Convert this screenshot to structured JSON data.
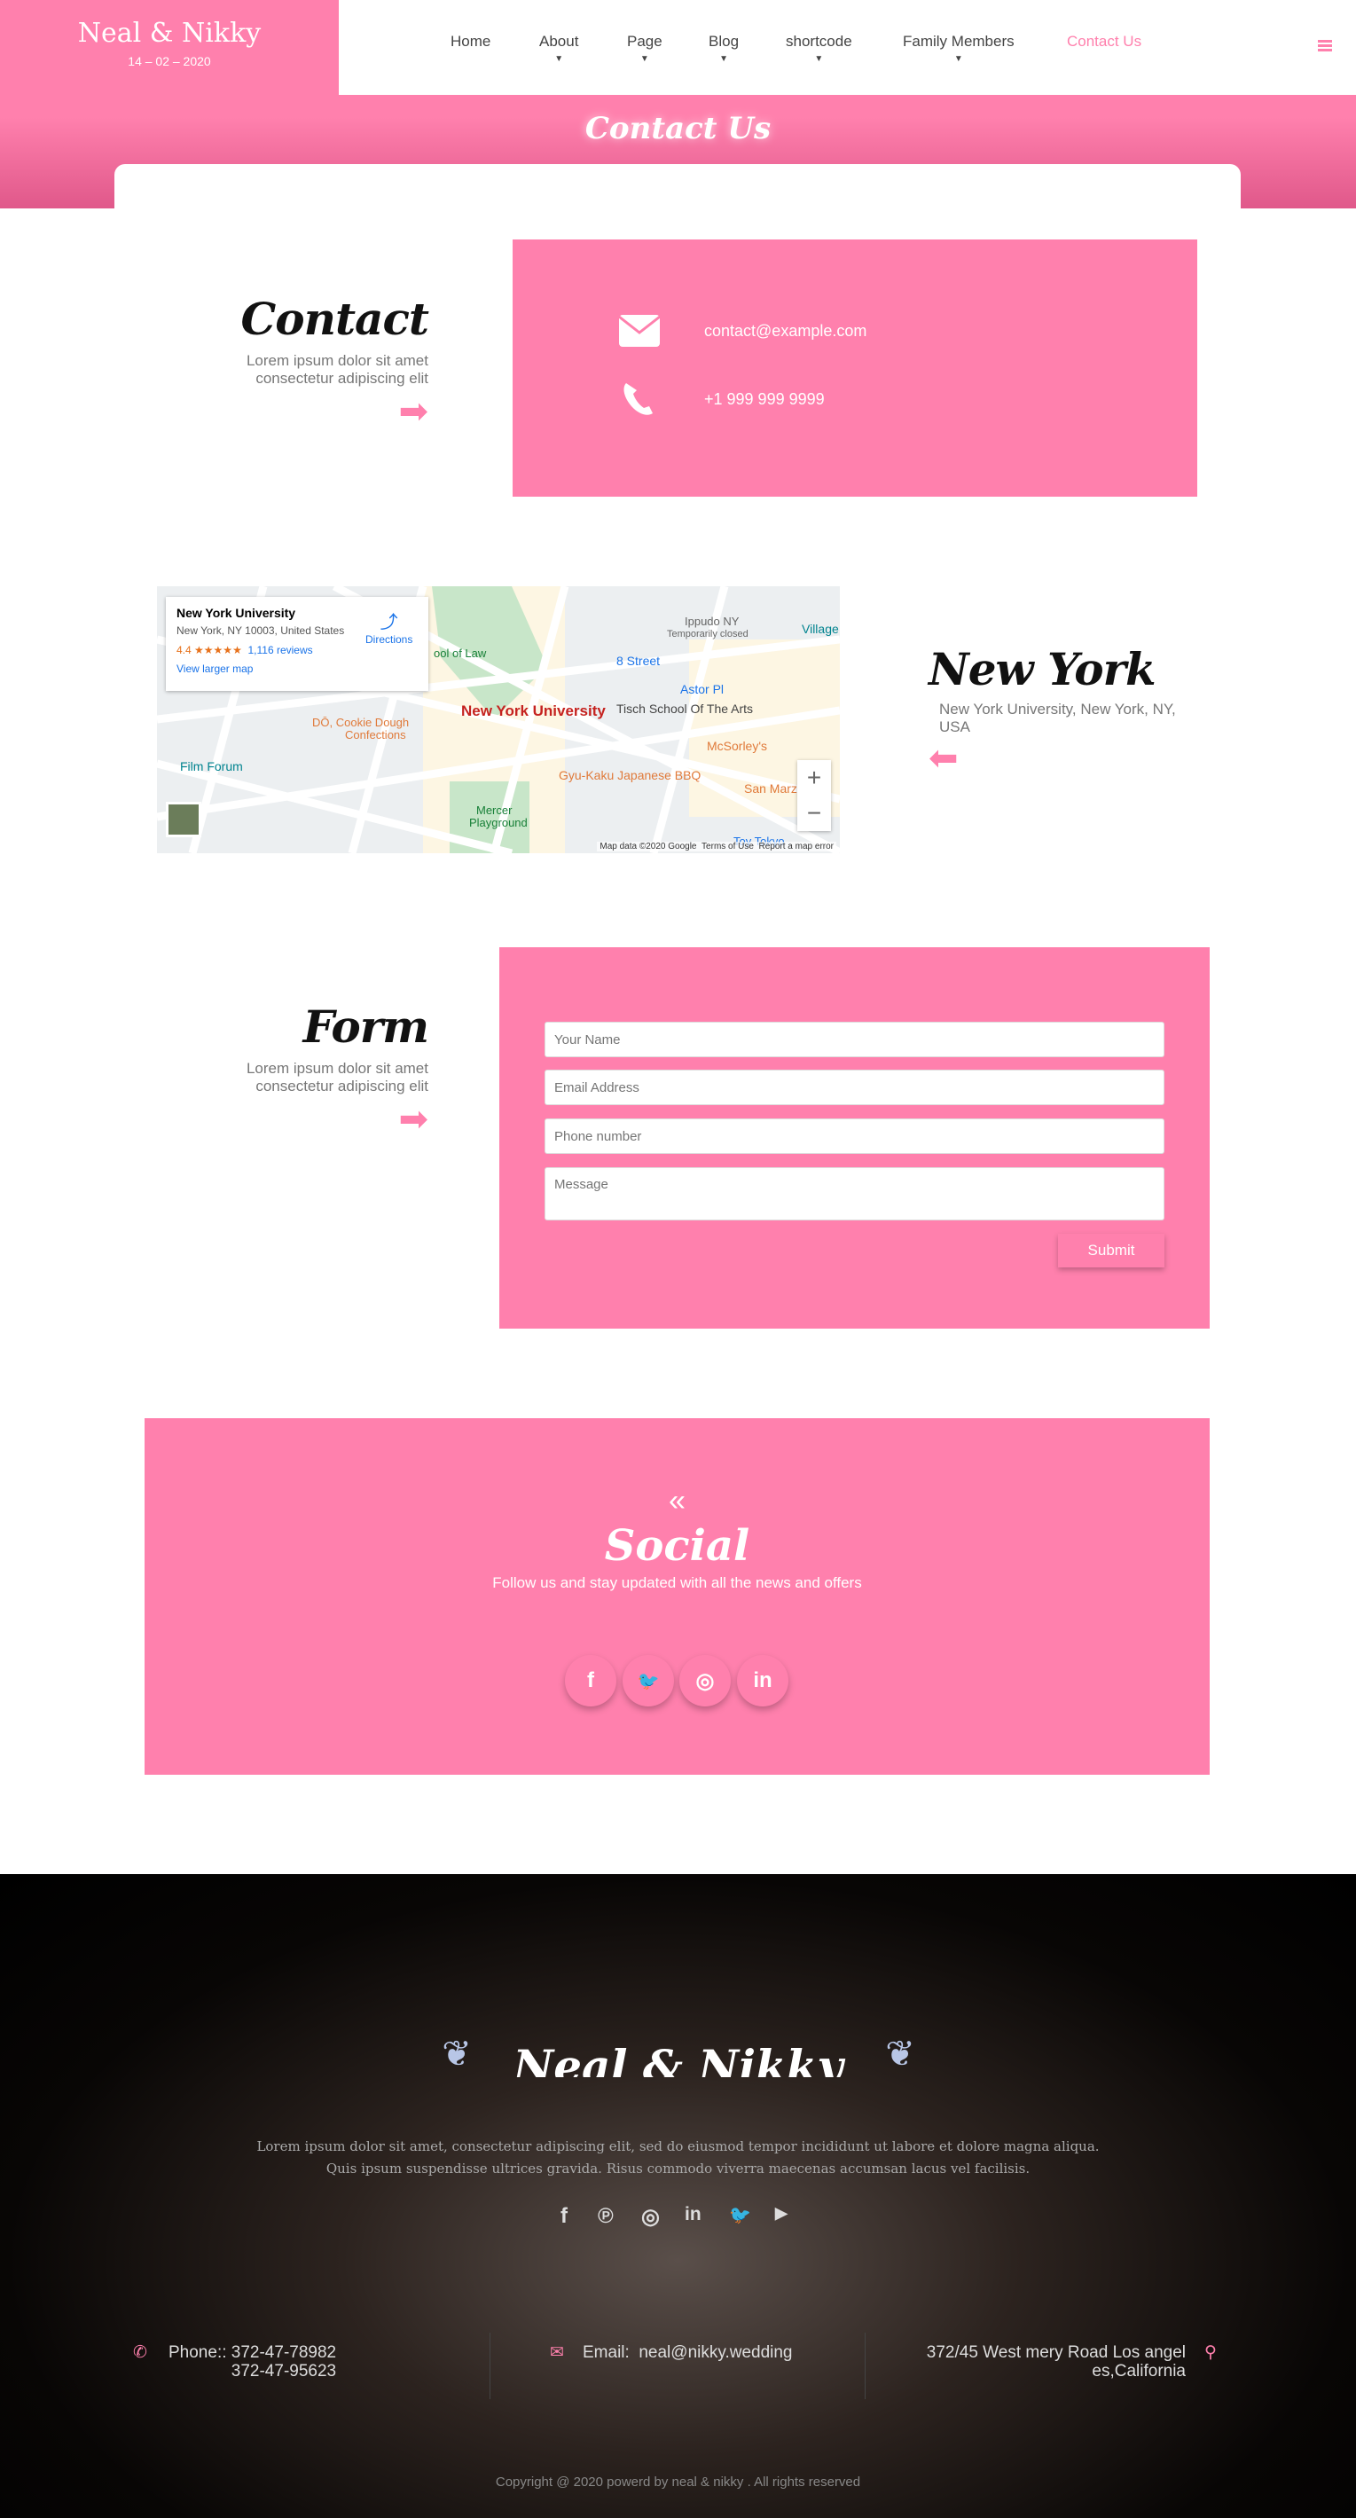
{
  "brand": {
    "title": "Neal & Nikky",
    "date": "14 – 02 – 2020"
  },
  "nav": {
    "items": [
      {
        "label": "Home",
        "dropdown": false
      },
      {
        "label": "About",
        "dropdown": true
      },
      {
        "label": "Page",
        "dropdown": true
      },
      {
        "label": "Blog",
        "dropdown": true
      },
      {
        "label": "shortcode",
        "dropdown": true
      },
      {
        "label": "Family Members",
        "dropdown": true
      },
      {
        "label": "Contact Us",
        "dropdown": false,
        "active": true
      }
    ],
    "menu_icon": "hamburger-icon"
  },
  "banner": {
    "title": "Contact Us"
  },
  "contact": {
    "title": "Contact",
    "subtitle_1": "Lorem ipsum dolor sit amet",
    "subtitle_2": "consectetur adipiscing elit",
    "email": "contact@example.com",
    "phone": "+1 999 999 9999"
  },
  "map": {
    "place": "New York University",
    "address": "New York, NY 10003, United States",
    "rating": "4.4",
    "stars": "★★★★★",
    "reviews": "1,116 reviews",
    "directions": "Directions",
    "larger": "View larger map",
    "labels": [
      "New York University",
      "Tisch School Of The Arts",
      "Astor Pl",
      "8 Street",
      "Ippudo NY",
      "Temporarily closed",
      "Village",
      "DŌ, Cookie Dough",
      "Confections",
      "Film Forum",
      "Gyu-Kaku Japanese BBQ",
      "McSorley's",
      "San Marz",
      "Mercer",
      "Playground",
      "ool of Law",
      "Toy Tokyo"
    ],
    "attribution": "Map data ©2020 Google",
    "terms": "Terms of Use",
    "report": "Report a map error",
    "zoom_in": "+",
    "zoom_out": "−"
  },
  "location": {
    "title": "New York",
    "address": "New York University, New York, NY, USA"
  },
  "form": {
    "title": "Form",
    "subtitle_1": "Lorem ipsum dolor sit amet",
    "subtitle_2": "consectetur adipiscing elit",
    "name_placeholder": "Your Name",
    "email_placeholder": "Email Address",
    "phone_placeholder": "Phone number",
    "message_placeholder": "Message",
    "submit": "Submit"
  },
  "social": {
    "title": "Social",
    "subtitle": "Follow us and stay updated with all the news and offers",
    "icons": [
      {
        "name": "facebook",
        "glyph": "f"
      },
      {
        "name": "twitter",
        "glyph": "🐦"
      },
      {
        "name": "instagram",
        "glyph": "◎"
      },
      {
        "name": "linkedin",
        "glyph": "in"
      }
    ]
  },
  "footer": {
    "title": "Neal & Nikky",
    "text_1": "Lorem ipsum dolor sit amet, consectetur adipiscing elit, sed do eiusmod tempor incididunt ut labore et dolore magna aliqua.",
    "text_2": "Quis ipsum suspendisse ultrices gravida. Risus commodo viverra maecenas accumsan lacus vel facilisis.",
    "icons": [
      {
        "name": "facebook",
        "glyph": "f"
      },
      {
        "name": "pinterest",
        "glyph": "℗"
      },
      {
        "name": "instagram",
        "glyph": "◎"
      },
      {
        "name": "linkedin",
        "glyph": "in"
      },
      {
        "name": "twitter",
        "glyph": "🐦"
      },
      {
        "name": "youtube",
        "glyph": "▶"
      }
    ],
    "phone_label": "Phone::",
    "phone_1": "372-47-78982",
    "phone_2": "372-47-95623",
    "email_label": "Email:",
    "email": "neal@nikky.wedding",
    "address_1": "372/45 West mery Road Los angel",
    "address_2": "es,California",
    "copyright": "Copyright @ 2020 powerd by neal & nikky . All rights reserved"
  },
  "colors": {
    "accent": "#ff80ad",
    "dark": "#111111"
  }
}
